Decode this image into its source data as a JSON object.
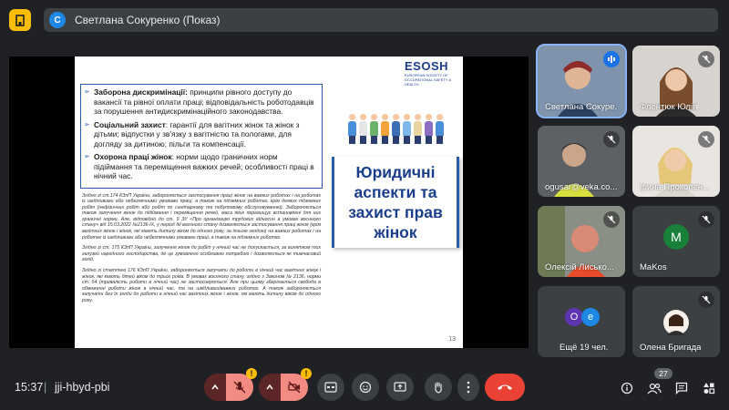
{
  "presenter": {
    "avatar_letter": "С",
    "title": "Светлана Сокуренко (Показ)"
  },
  "slide": {
    "logo": "ESOSH",
    "logo_sub": "EUROPEAN SOCIETY OF OCCUPATIONAL SAFETY & HEALTH",
    "bullets": [
      {
        "head": "Заборона дискримінації:",
        "text": " принципи рівного доступу до вакансії та рівної оплати праці; відповідальність роботодавців за порушення антидискримінаційного законодавства."
      },
      {
        "head": "Соціальний захист",
        "text": ": гарантії для вагітних жінок та жінок з дітьми; відпустки у зв'язку з вагітністю та пологами, для догляду за дитиною; пільги та компенсації."
      },
      {
        "head": "Охорона праці жінок",
        "text": ": норми щодо граничних норм підіймання та переміщення важких речей; особливості праці в нічний час."
      }
    ],
    "fine_print": [
      "Згідно зі ст.174 КЗпП України, забороняється застосування праці жінок на важких роботах і на роботах із шкідливими або небезпечними умовами праці, а також на підземних роботах, крім деяких підземних робіт (нефізичних робіт або робіт по санітарному та побутовому обслуговуванню). Забороняється також залучення жінок до підіймання і переміщення речей, маса яких перевищує встановлені для них граничні норми. Але, відповідно до ст. 9 ЗУ «Про організацію трудових відносин в умовах воєнного стану» від 15.03.2022 №2136-IX, у період дії воєнного стану дозволяється застосування праці жінок (крім вагітних жінок і жінок, які мають дитину віком до одного року, за їхньою згодою) на важких роботах і на роботах із шкідливими або небезпечними умовами праці, а також на підземних роботах.",
      "Згідно зі ст. 175 КЗпП України, залучення жінок до робіт у нічний час не допускається, за винятком тих галузей народного господарства, де це зумовлено особливою потребою і дозволяється як тимчасовий захід.",
      "Згідно зі статтею 176 КЗпП України, забороняється залучати до роботи в нічний час вагітних жінок і жінок, які мають дітей віком до трьох років. В умовах воєнного стану, згідно з Законом № 2136, норми ст. 54 (тривалість роботи в нічний час) не застосовуються. Але при цьому зберігається свобода в обмеженні роботи жінок в нічний час, та на шкідливих/важких роботах. А також забороняється залучати без їх згоди до роботи в нічний час вагітних жінок і жінок, які мають дитину віком до одного року."
    ],
    "title_lines": [
      "Юридичні",
      "аспекти та",
      "захист прав",
      "жінок"
    ],
    "page_number": "13"
  },
  "participants": [
    {
      "name": "Светлана Сокуре...",
      "mic": "speaking"
    },
    {
      "name": "Флентюк Юлія",
      "mic": "muted"
    },
    {
      "name": "ogusar@veka.co...",
      "mic": "muted"
    },
    {
      "name": "Ірина Прокопен...",
      "mic": "muted"
    },
    {
      "name": "Олексій Лисько...",
      "mic": "muted"
    },
    {
      "name": "MaKos",
      "mic": "muted",
      "avatar_letter": "M"
    },
    {
      "name": "Ещё 19 чел.",
      "avatar_letters": [
        "O",
        "e"
      ]
    },
    {
      "name": "Олена Бригада",
      "mic": "muted"
    }
  ],
  "bottom": {
    "time": "15:37",
    "separator": "|",
    "meeting_code": "jji-hbyd-pbi",
    "participant_count": "27",
    "warning_glyph": "!"
  },
  "colors": {
    "background": "#202124",
    "tile": "#3c4043",
    "accent_blue": "#1a73e8",
    "end_call": "#ea4335",
    "muted_pill": "#f28b82",
    "warning": "#fbbc04",
    "slide_title": "#1a3e8c"
  }
}
